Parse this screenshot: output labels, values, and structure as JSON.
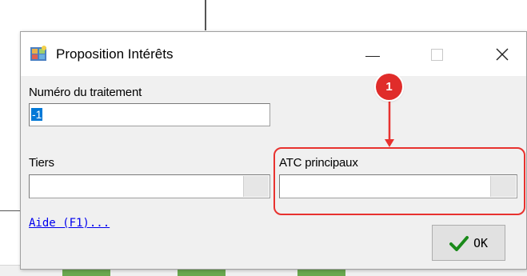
{
  "dialog": {
    "title": "Proposition Intérêts",
    "window_controls": {
      "minimize_glyph": "—",
      "maximize_glyph": "☐",
      "close_glyph": "✕"
    }
  },
  "form": {
    "numero_label": "Numéro du traitement",
    "numero_value": "-1",
    "tiers_label": "Tiers",
    "tiers_value": "",
    "atc_label": "ATC principaux",
    "atc_value": ""
  },
  "help_link": "Aide (F1)...",
  "ok_button": {
    "label": "OK",
    "icon": "checkmark-icon",
    "icon_color": "#1a8a1a"
  },
  "annotation": {
    "badge": "1",
    "color": "#e8322f"
  },
  "app_icon": "proposition-app-icon"
}
